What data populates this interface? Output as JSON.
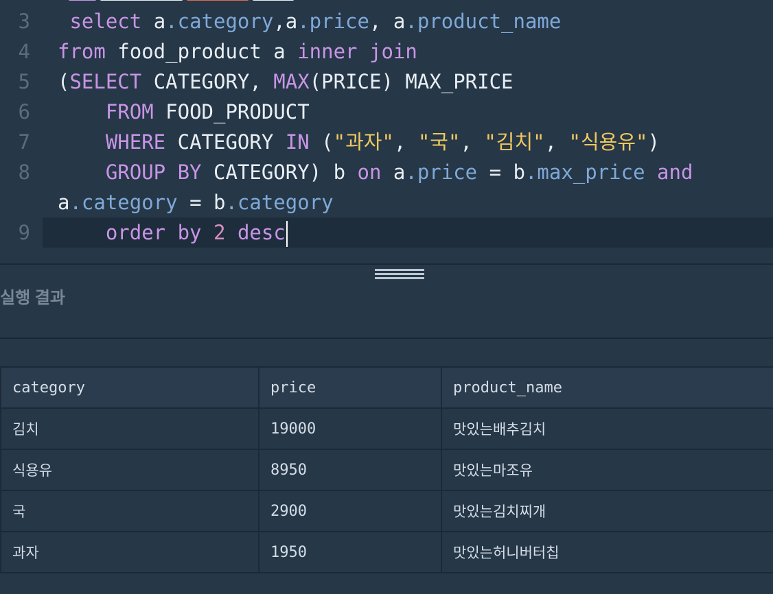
{
  "editor": {
    "lines": [
      {
        "num": "3",
        "tokens": [
          {
            "t": " "
          },
          {
            "t": "select",
            "c": "k"
          },
          {
            "t": " a"
          },
          {
            "t": ".category",
            "c": "p"
          },
          {
            "t": ",a"
          },
          {
            "t": ".price",
            "c": "p"
          },
          {
            "t": ", a"
          },
          {
            "t": ".product_name",
            "c": "p"
          }
        ]
      },
      {
        "num": "4",
        "tokens": [
          {
            "t": "from",
            "c": "k"
          },
          {
            "t": " food_product a "
          },
          {
            "t": "inner",
            "c": "k"
          },
          {
            "t": " "
          },
          {
            "t": "join",
            "c": "k"
          }
        ]
      },
      {
        "num": "5",
        "tokens": [
          {
            "t": "("
          },
          {
            "t": "SELECT",
            "c": "k"
          },
          {
            "t": " CATEGORY, "
          },
          {
            "t": "MAX",
            "c": "k"
          },
          {
            "t": "(PRICE) MAX_PRICE"
          }
        ]
      },
      {
        "num": "6",
        "tokens": [
          {
            "t": "    "
          },
          {
            "t": "FROM",
            "c": "k"
          },
          {
            "t": " FOOD_PRODUCT"
          }
        ]
      },
      {
        "num": "7",
        "tokens": [
          {
            "t": "    "
          },
          {
            "t": "WHERE",
            "c": "k"
          },
          {
            "t": " CATEGORY "
          },
          {
            "t": "IN",
            "c": "k"
          },
          {
            "t": " ("
          },
          {
            "t": "\"과자\"",
            "c": "s"
          },
          {
            "t": ", "
          },
          {
            "t": "\"국\"",
            "c": "s"
          },
          {
            "t": ", "
          },
          {
            "t": "\"김치\"",
            "c": "s"
          },
          {
            "t": ", "
          },
          {
            "t": "\"식용유\"",
            "c": "s"
          },
          {
            "t": ")"
          }
        ]
      },
      {
        "num": "8",
        "tokens": [
          {
            "t": "    "
          },
          {
            "t": "GROUP BY",
            "c": "k"
          },
          {
            "t": " CATEGORY) b "
          },
          {
            "t": "on",
            "c": "k"
          },
          {
            "t": " a"
          },
          {
            "t": ".price",
            "c": "p"
          },
          {
            "t": " = b"
          },
          {
            "t": ".max_price",
            "c": "p"
          },
          {
            "t": " "
          },
          {
            "t": "and",
            "c": "k"
          }
        ]
      },
      {
        "num": "",
        "tokens": [
          {
            "t": "a"
          },
          {
            "t": ".category",
            "c": "p"
          },
          {
            "t": " = b"
          },
          {
            "t": ".category",
            "c": "p"
          }
        ]
      },
      {
        "num": "9",
        "active": true,
        "tokens": [
          {
            "t": "    "
          },
          {
            "t": "order by",
            "c": "k"
          },
          {
            "t": " "
          },
          {
            "t": "2",
            "c": "n"
          },
          {
            "t": " "
          },
          {
            "t": "desc",
            "c": "k"
          }
        ]
      }
    ]
  },
  "results": {
    "title": "실행 결과",
    "columns": [
      "category",
      "price",
      "product_name"
    ],
    "rows": [
      [
        "김치",
        "19000",
        "맛있는배추김치"
      ],
      [
        "식용유",
        "8950",
        "맛있는마조유"
      ],
      [
        "국",
        "2900",
        "맛있는김치찌개"
      ],
      [
        "과자",
        "1950",
        "맛있는허니버터칩"
      ]
    ]
  }
}
